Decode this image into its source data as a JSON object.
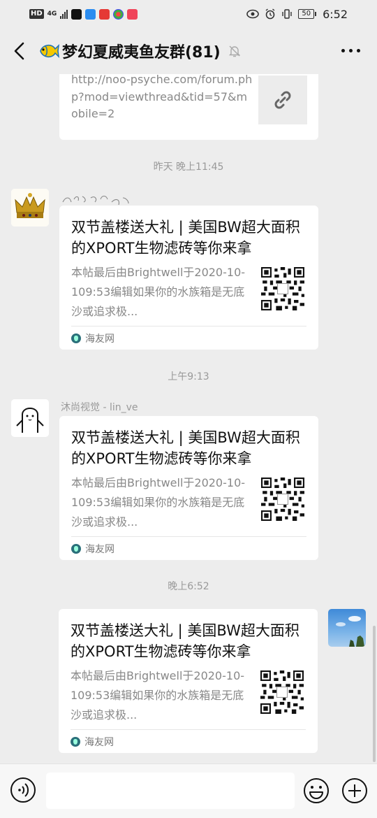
{
  "status": {
    "network": "4G",
    "battery": "50",
    "time": "6:52"
  },
  "header": {
    "title": "梦幻夏威夷鱼友群(81)",
    "title_icon": "yellow-tang-fish-icon"
  },
  "messages": {
    "m0": {
      "url": "http://noo-psyche.com/forum.php?mod=viewthread&tid=57&mobile=2"
    },
    "t1": "昨天 晚上11:45",
    "m1": {
      "title": "双节盖楼送大礼 | 美国BW超大面积的XPORT生物滤砖等你来拿",
      "desc": "本帖最后由Brightwell于2020-10-109:53编辑如果你的水族箱是无底沙或追求极...",
      "source": "海友网"
    },
    "t2": "上午9:13",
    "m2": {
      "sender": "沐尚视觉 - lin_ve",
      "title": "双节盖楼送大礼 | 美国BW超大面积的XPORT生物滤砖等你来拿",
      "desc": "本帖最后由Brightwell于2020-10-109:53编辑如果你的水族箱是无底沙或追求极...",
      "source": "海友网"
    },
    "t3": "晚上6:52",
    "m3": {
      "title": "双节盖楼送大礼 | 美国BW超大面积的XPORT生物滤砖等你来拿",
      "desc": "本帖最后由Brightwell于2020-10-109:53编辑如果你的水族箱是无底沙或追求极...",
      "source": "海友网"
    }
  },
  "colors": {
    "background": "#ededed",
    "card": "#ffffff",
    "source_icon": "#2a6f7a"
  }
}
